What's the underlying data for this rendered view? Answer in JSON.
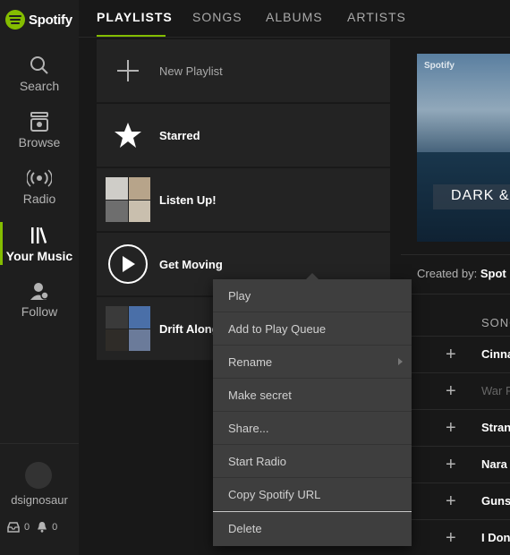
{
  "app": {
    "name": "Spotify"
  },
  "sidebar": {
    "items": [
      {
        "label": "Search",
        "icon": "search-icon"
      },
      {
        "label": "Browse",
        "icon": "browse-icon"
      },
      {
        "label": "Radio",
        "icon": "radio-icon"
      },
      {
        "label": "Your Music",
        "icon": "library-icon",
        "active": true
      },
      {
        "label": "Follow",
        "icon": "follow-icon"
      }
    ],
    "user": {
      "name": "dsignosaur",
      "inbox_count": "0",
      "notification_count": "0"
    }
  },
  "tabs": [
    {
      "label": "PLAYLISTS",
      "active": true
    },
    {
      "label": "SONGS"
    },
    {
      "label": "ALBUMS"
    },
    {
      "label": "ARTISTS"
    }
  ],
  "playlists": [
    {
      "label": "New Playlist",
      "icon": "plus-icon"
    },
    {
      "label": "Starred",
      "icon": "star-icon"
    },
    {
      "label": "Listen Up!",
      "icon": "album-mosaic"
    },
    {
      "label": "Get Moving",
      "icon": "play-icon"
    },
    {
      "label": "Drift Along",
      "icon": "album-mosaic"
    }
  ],
  "detail": {
    "cover_brand": "Spotify",
    "cover_text": "DARK &",
    "created_by_label": "Created by:",
    "created_by_value": "Spot",
    "songs_header": "SONG",
    "songs": [
      {
        "title": "Cinna"
      },
      {
        "title": "War F",
        "dimmed": true
      },
      {
        "title": "Stran"
      },
      {
        "title": "Nara"
      },
      {
        "title": "Guns"
      },
      {
        "title": "I Don"
      }
    ]
  },
  "context_menu": {
    "items": [
      {
        "label": "Play"
      },
      {
        "label": "Add to Play Queue"
      },
      {
        "label": "Rename",
        "has_submenu": true
      },
      {
        "label": "Make secret"
      },
      {
        "label": "Share..."
      },
      {
        "label": "Start Radio"
      },
      {
        "label": "Copy Spotify URL"
      },
      {
        "label": "Delete"
      }
    ]
  },
  "colors": {
    "accent": "#84bd00",
    "background": "#181818",
    "panel": "#232323",
    "menu": "#3e3e3e"
  }
}
